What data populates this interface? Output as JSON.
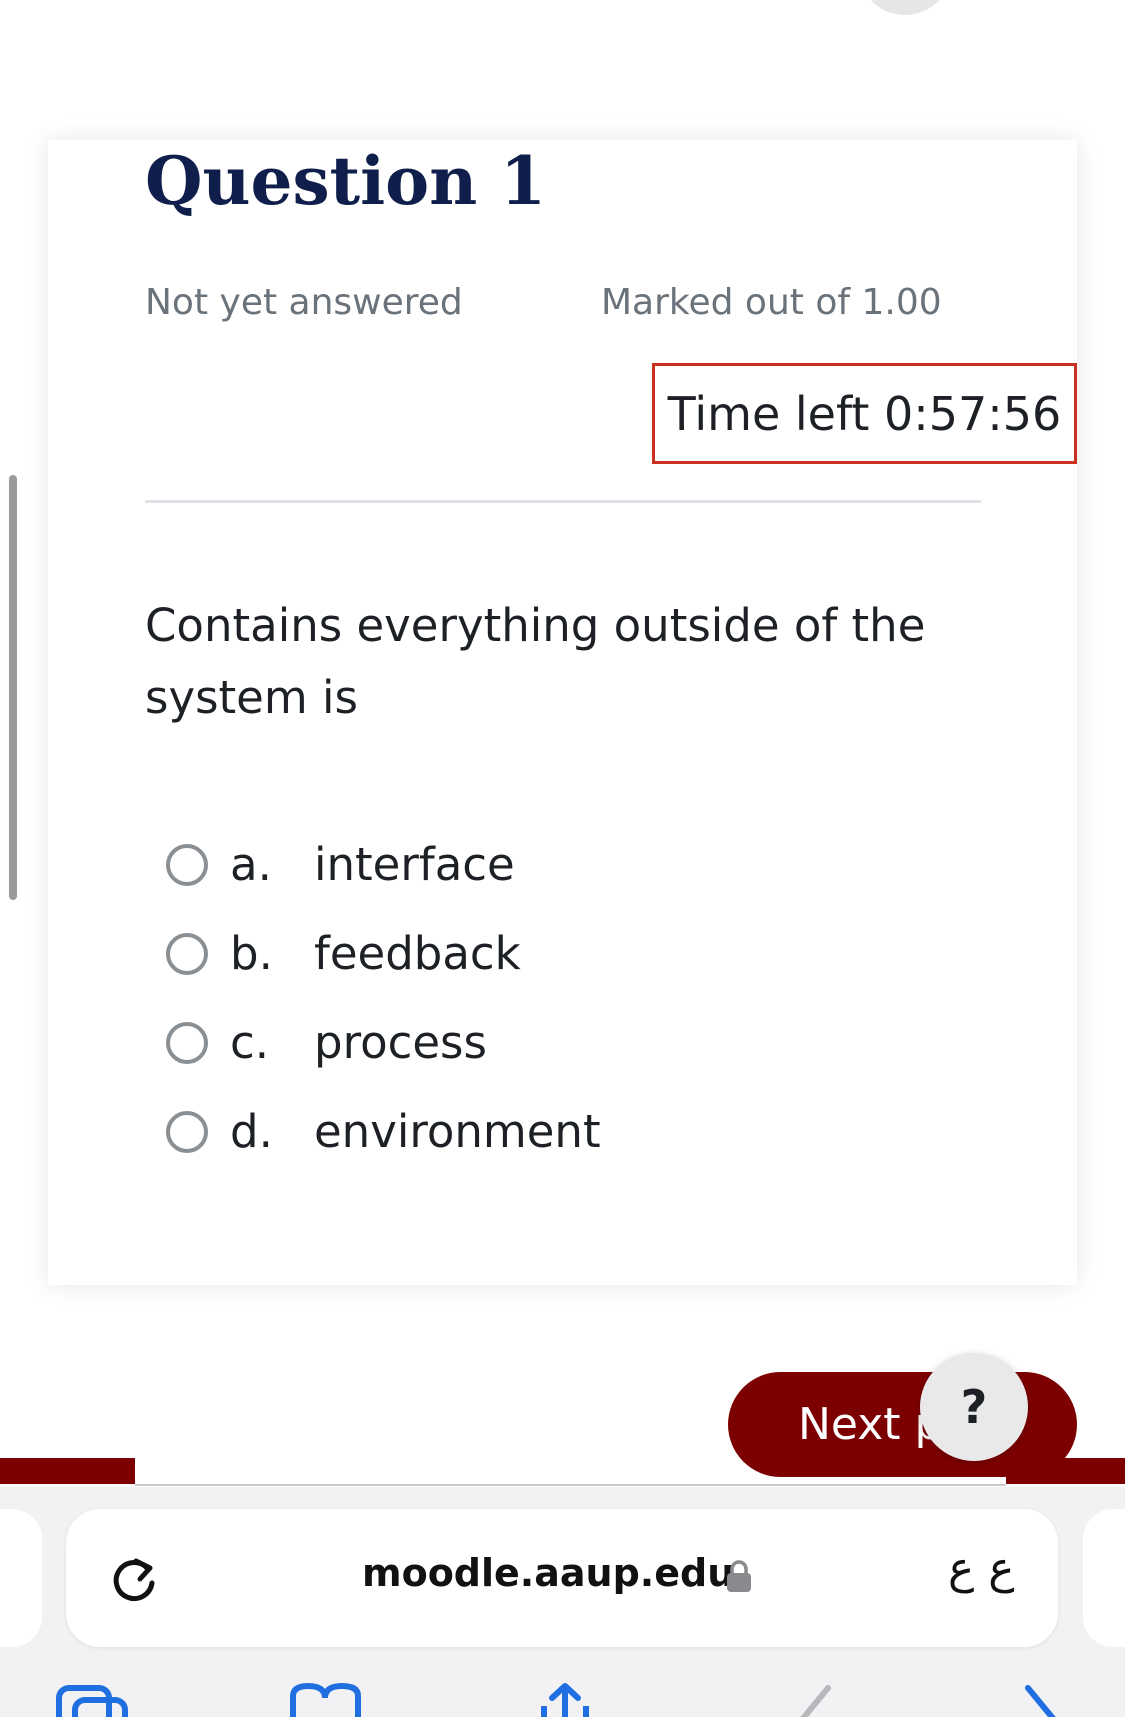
{
  "question": {
    "title": "Question 1",
    "state": "Not yet answered",
    "grade": "Marked out of 1.00",
    "text": "Contains everything outside of the system is",
    "answers": [
      {
        "letter": "a.",
        "text": "interface"
      },
      {
        "letter": "b.",
        "text": "feedback"
      },
      {
        "letter": "c.",
        "text": "process"
      },
      {
        "letter": "d.",
        "text": "environment"
      }
    ]
  },
  "timer": {
    "label": "Time left 0:57:56"
  },
  "navigation": {
    "next_label": "Next p",
    "help_label": "?"
  },
  "browser": {
    "url": "moodle.aaup.edu",
    "reader_label": "ع ع"
  },
  "colors": {
    "accent": "#7d0000",
    "timer_border": "#ca3120",
    "title": "#0f1e4a",
    "muted_text": "#6a737b"
  },
  "icons": {
    "reload": "reload-icon",
    "lock": "lock-icon",
    "help": "question-mark-icon",
    "tabs": "tabs-icon",
    "bookmarks": "bookmarks-icon",
    "share": "share-icon",
    "back": "back-chevron-icon",
    "forward": "forward-chevron-icon"
  }
}
